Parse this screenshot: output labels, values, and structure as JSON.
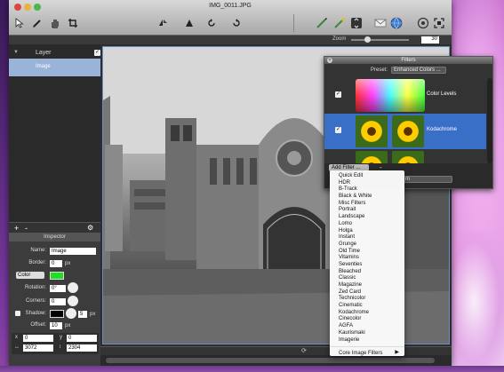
{
  "window": {
    "title": "IMG_0011.JPG"
  },
  "toolbar": {
    "left_icons": [
      "arrow-pointer-icon",
      "pencil-icon",
      "hand-icon",
      "crop-icon"
    ],
    "mid_icons": [
      "flip-icon",
      "skew-icon",
      "rotate-left-icon",
      "rotate-right-icon"
    ],
    "right_icons": [
      "brush-icon",
      "magic-wand-icon",
      "adjust-icon",
      "mail-icon",
      "globe-icon",
      "info-icon",
      "fullscreen-icon"
    ]
  },
  "zoom": {
    "label": "Zoom",
    "value": "30",
    "slider_fraction": 0.28
  },
  "layers": {
    "title": "Layer",
    "items": [
      {
        "label": "Image"
      }
    ],
    "add": "+",
    "remove": "-",
    "gear": "⚙"
  },
  "inspector": {
    "title": "Inspector",
    "name_label": "Name:",
    "name_value": "Image",
    "border_label": "Border:",
    "border_value": "0",
    "border_unit": "px",
    "color_select": "Color",
    "rotation_label": "Rotation:",
    "rotation_value": "0°",
    "corners_label": "Corners:",
    "corners_value": "0",
    "shadow_label": "Shadow:",
    "shadow_value": "5",
    "shadow_unit": "px",
    "offset_label": "Offset:",
    "offset_value": "10",
    "offset_unit": "px",
    "x_label": "x",
    "x_value": "0",
    "y_label": "y",
    "y_value": "0",
    "w_value": "3072",
    "h_value": "2304",
    "swatch_color": "#22dd22"
  },
  "filters": {
    "title": "Filters",
    "preset_label": "Preset:",
    "preset_value": "Enhanced Colors ...",
    "items": [
      {
        "label": "Color Levels"
      },
      {
        "label": "Kodachrome"
      }
    ],
    "add_button": "Add Filter ...",
    "remove": "-",
    "mode_value": "m"
  },
  "add_menu": {
    "items": [
      "Quick Edit",
      "HDR",
      "B-Track",
      "Black & White",
      "Misc Filters",
      "Portrait",
      "Landscape",
      "Lomo",
      "Holga",
      "Instant",
      "Grunge",
      "Old Time",
      "Vitamins",
      "Seventies",
      "Bleached",
      "Classic",
      "Magazine",
      "Zed Card",
      "Technicolor",
      "Cinematic",
      "Kodachrome",
      "Cinecolor",
      "AGFA",
      "Kaurismaki",
      "Imagerie"
    ],
    "footer": "Core Image Filters"
  },
  "colors": {
    "selection": "#3a6fc8",
    "panel": "#2b2b2b",
    "layer_selected": "#9ab3d8"
  }
}
